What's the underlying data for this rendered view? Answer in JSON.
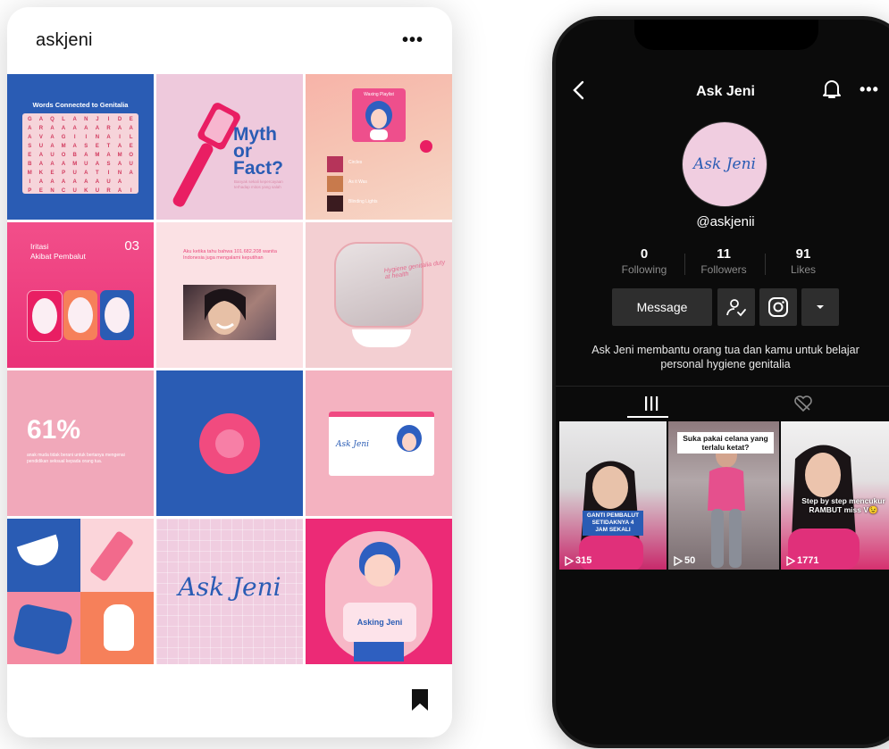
{
  "instagram": {
    "username": "askjeni",
    "more_icon": "more-horizontal-icon",
    "bookmark_icon": "bookmark-icon",
    "tiles": {
      "wordsearch_title": "Words Connected to Genitalia",
      "wordsearch_rows": [
        "GAQLANJIDE",
        "ARAAAAARAA",
        "AVAGIINAIL",
        "SUAMASETAE",
        "EAUOBAMAMO",
        "BAAAMUASAU",
        "MKEPUATINA",
        "IAAAAAAUA",
        "PENCUKURAI"
      ],
      "myth_title": "Myth\nor\nFact?",
      "myth_body": "Banyak sekali kepercayaan terhadap mitos yang salah",
      "playlist_title": "Waxing Playlist",
      "playlist_tracks": [
        "Circles",
        "As it Was",
        "Blinding Lights"
      ],
      "iritasi_title": "Iritasi\nAkibat Pembalut",
      "iritasi_number": "03",
      "fact_text": "Aku ketika tahu bahwa 101.682.208 wanita Indonesia juga mengalami keputihan",
      "hygiene_text": "Hygiene genitalia duty at health",
      "stat_value": "61%",
      "stat_text": "anak muda tidak berani untuk bertanya mengenai pendidikan seksual kepada orang tua.",
      "site_logo": "Ask Jeni",
      "brand_logo": "Ask Jeni",
      "asking_label": "Asking Jeni"
    }
  },
  "tiktok": {
    "title": "Ask Jeni",
    "back_icon": "chevron-left-icon",
    "bell_icon": "bell-icon",
    "more_icon": "more-horizontal-icon",
    "avatar_logo": "Ask Jeni",
    "handle": "@askjenii",
    "stats": [
      {
        "value": "0",
        "label": "Following"
      },
      {
        "value": "11",
        "label": "Followers"
      },
      {
        "value": "91",
        "label": "Likes"
      }
    ],
    "message_label": "Message",
    "bio": "Ask Jeni membantu orang tua dan kamu untuk belajar personal hygiene genitalia",
    "videos": [
      {
        "caption": "GANTI PEMBALUT SETIDAKNYA 4 JAM SEKALI",
        "views": "315"
      },
      {
        "caption": "Suka pakai celana yang terlalu ketat?",
        "views": "50"
      },
      {
        "caption": "Step by step mencukur RAMBUT miss V😉",
        "views": "1771"
      }
    ],
    "colors": {
      "background": "#0b0b0b",
      "button": "#2e2e2e",
      "muted": "#8a8a8a"
    }
  }
}
